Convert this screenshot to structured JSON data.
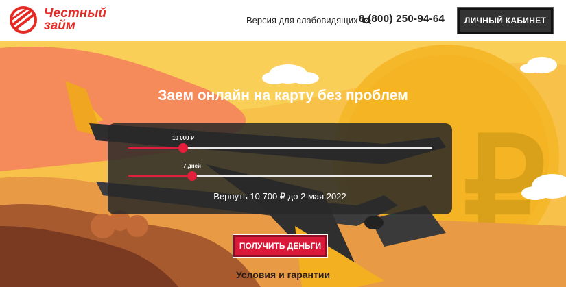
{
  "header": {
    "logo_line1": "Честный",
    "logo_line2": "займ",
    "accessibility_label": "Версия для слабовидящих",
    "phone": "8 (800) 250-94-64",
    "cabinet_label": "ЛИЧНЫЙ КАБИНЕТ"
  },
  "hero": {
    "headline": "Заем онлайн на карту без проблем"
  },
  "calculator": {
    "amount_label": "10 000 ₽",
    "amount_fraction": 0.18,
    "term_label": "7 дней",
    "term_fraction": 0.21,
    "repay_text": "Вернуть 10 700 ₽ до 2 мая 2022"
  },
  "cta": {
    "button_label": "ПОЛУЧИТЬ ДЕНЬГИ",
    "terms_link": "Условия и гарантии"
  },
  "colors": {
    "brand_red": "#e52a24",
    "slider_red": "#e0203a",
    "background_yellow": "#f6bf45"
  }
}
